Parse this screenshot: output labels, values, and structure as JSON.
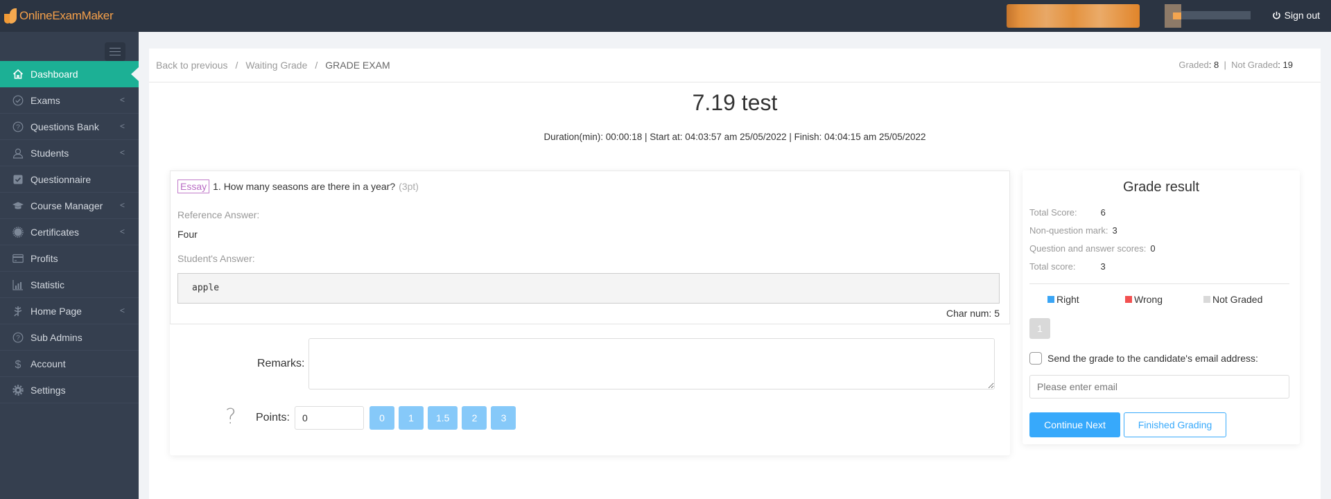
{
  "header": {
    "brand": "OnlineExamMaker",
    "sign_out": "Sign out"
  },
  "sidebar": {
    "items": [
      {
        "label": "Dashboard",
        "icon": "home-icon",
        "active": true,
        "has_submenu": false
      },
      {
        "label": "Exams",
        "icon": "check-circle-icon",
        "has_submenu": true
      },
      {
        "label": "Questions Bank",
        "icon": "question-circle-icon",
        "has_submenu": true
      },
      {
        "label": "Students",
        "icon": "user-icon",
        "has_submenu": true
      },
      {
        "label": "Questionnaire",
        "icon": "checkbox-icon",
        "has_submenu": false
      },
      {
        "label": "Course Manager",
        "icon": "graduation-cap-icon",
        "has_submenu": true
      },
      {
        "label": "Certificates",
        "icon": "certificate-icon",
        "has_submenu": true
      },
      {
        "label": "Profits",
        "icon": "credit-card-icon",
        "has_submenu": false
      },
      {
        "label": "Statistic",
        "icon": "bar-chart-icon",
        "has_submenu": false
      },
      {
        "label": "Home Page",
        "icon": "leaf-icon",
        "has_submenu": true
      },
      {
        "label": "Sub Admins",
        "icon": "question-circle-icon",
        "has_submenu": false
      },
      {
        "label": "Account",
        "icon": "dollar-icon",
        "has_submenu": false
      },
      {
        "label": "Settings",
        "icon": "gear-icon",
        "has_submenu": false
      }
    ],
    "chevron": "<"
  },
  "breadcrumb": {
    "items": [
      "Back to previous",
      "Waiting Grade",
      "GRADE EXAM"
    ],
    "separator": "/"
  },
  "grading_stats": {
    "graded_label": "Graded",
    "graded_value": "8",
    "not_graded_label": "Not Graded",
    "not_graded_value": "19"
  },
  "exam": {
    "title": "7.19 test",
    "meta": "Duration(min): 00:00:18 | Start at: 04:03:57 am 25/05/2022 | Finish: 04:04:15 am 25/05/2022"
  },
  "question": {
    "type_tag": "Essay",
    "text": "1. How many seasons are there in a year?",
    "points": "(3pt)",
    "reference_label": "Reference Answer:",
    "reference_answer": "Four",
    "student_label": "Student's Answer:",
    "student_answer": "apple",
    "char_num": "Char num: 5",
    "remarks_label": "Remarks:",
    "remarks_value": "",
    "points_label": "Points:",
    "points_value": "0",
    "point_options": [
      "0",
      "1",
      "1.5",
      "2",
      "3"
    ]
  },
  "grade_result": {
    "title": "Grade result",
    "rows": [
      {
        "label": "Total Score:",
        "value": "6"
      },
      {
        "label": "Non-question mark:",
        "value": "3"
      },
      {
        "label": "Question and answer scores:",
        "value": "0"
      },
      {
        "label": "Total score:",
        "value": "3"
      }
    ],
    "legend": [
      {
        "label": "Right",
        "color": "#3aa5f5"
      },
      {
        "label": "Wrong",
        "color": "#f25050"
      },
      {
        "label": "Not Graded",
        "color": "#d9d9d9"
      }
    ],
    "question_numbers": [
      "1"
    ],
    "send_email_label": "Send the grade to the candidate's email address:",
    "send_email_checked": false,
    "email_placeholder": "Please enter email",
    "continue_label": "Continue Next",
    "finish_label": "Finished Grading"
  }
}
